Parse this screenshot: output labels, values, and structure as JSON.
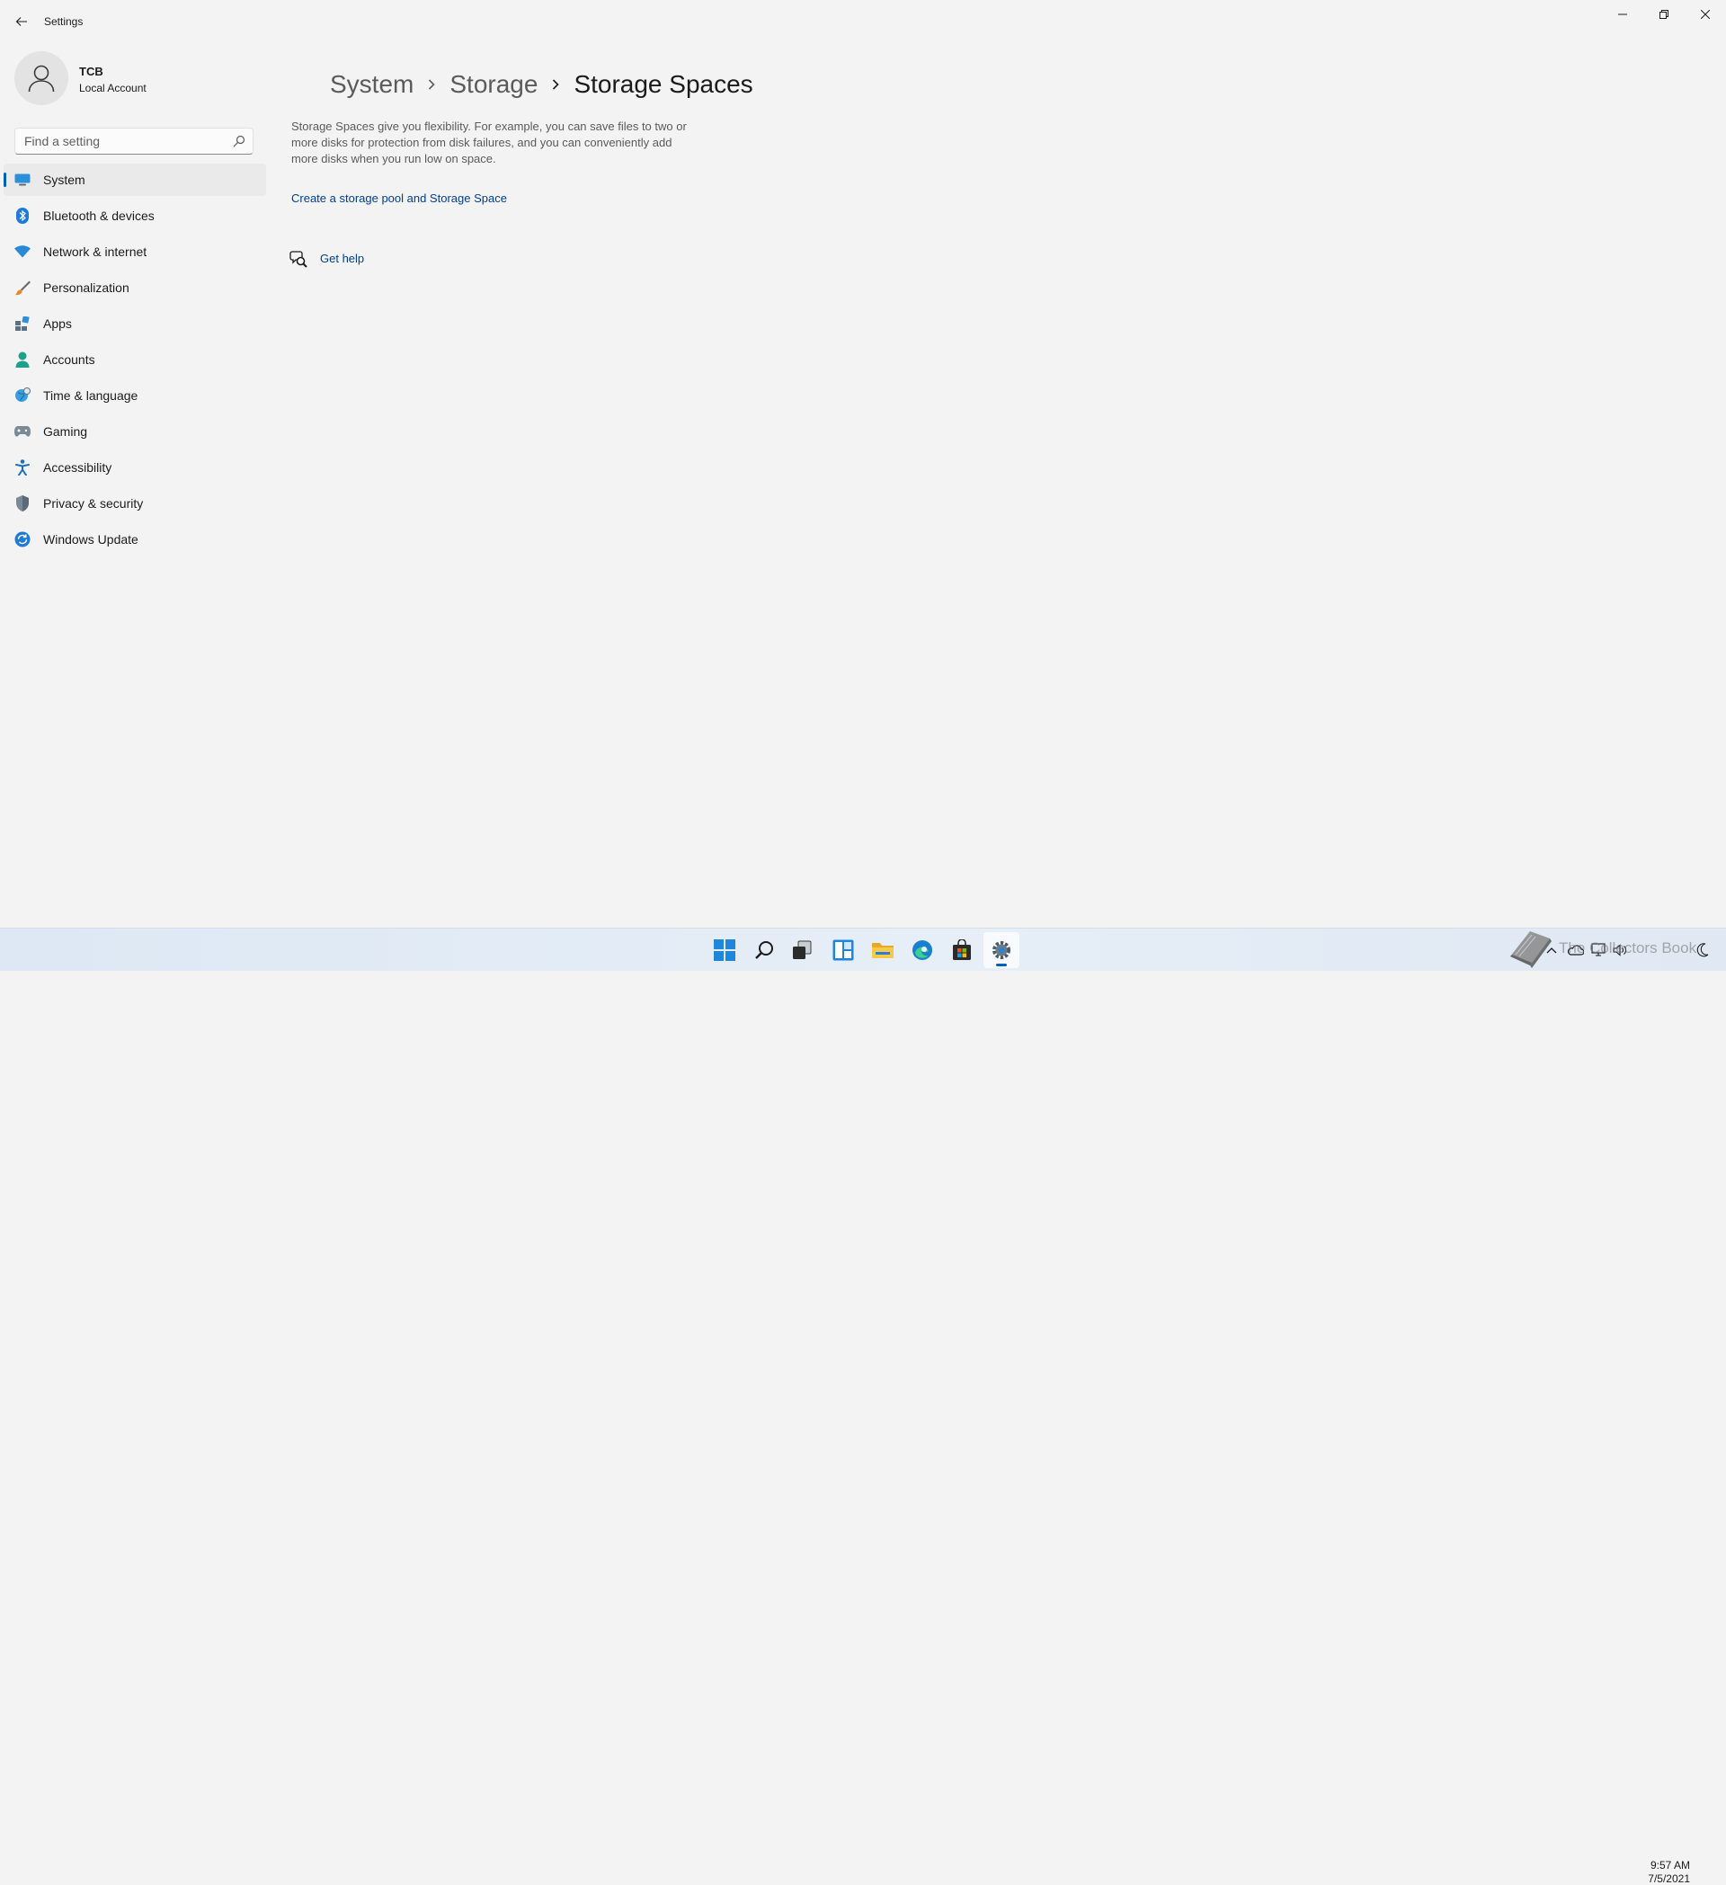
{
  "window": {
    "title": "Settings"
  },
  "profile": {
    "name": "TCB",
    "account_type": "Local Account"
  },
  "search": {
    "placeholder": "Find a setting"
  },
  "sidebar": {
    "items": [
      {
        "label": "System",
        "icon": "system-icon",
        "selected": true
      },
      {
        "label": "Bluetooth & devices",
        "icon": "bluetooth-icon"
      },
      {
        "label": "Network & internet",
        "icon": "network-icon"
      },
      {
        "label": "Personalization",
        "icon": "personalization-brush-icon"
      },
      {
        "label": "Apps",
        "icon": "apps-icon"
      },
      {
        "label": "Accounts",
        "icon": "accounts-icon"
      },
      {
        "label": "Time & language",
        "icon": "time-language-icon"
      },
      {
        "label": "Gaming",
        "icon": "gaming-controller-icon"
      },
      {
        "label": "Accessibility",
        "icon": "accessibility-icon"
      },
      {
        "label": "Privacy & security",
        "icon": "shield-icon"
      },
      {
        "label": "Windows Update",
        "icon": "windows-update-icon"
      }
    ]
  },
  "breadcrumb": {
    "items": [
      "System",
      "Storage",
      "Storage Spaces"
    ]
  },
  "content": {
    "description": "Storage Spaces give you flexibility. For example, you can save files to two or more disks for protection from disk failures, and you can conveniently add more disks when you run low on space.",
    "create_link": "Create a storage pool and Storage Space",
    "help_link": "Get help"
  },
  "taskbar": {
    "apps": [
      "start-icon",
      "search-icon",
      "task-view-icon",
      "widgets-icon",
      "file-explorer-icon",
      "edge-icon",
      "store-icon",
      "settings-icon"
    ],
    "active_app": "settings-icon"
  },
  "tray": {
    "time": "9:57 AM",
    "date": "7/5/2021",
    "watermark": "The Collectors Book"
  },
  "colors": {
    "accent": "#005fb8",
    "link": "#003e92",
    "window_bg": "#f3f3f3"
  }
}
